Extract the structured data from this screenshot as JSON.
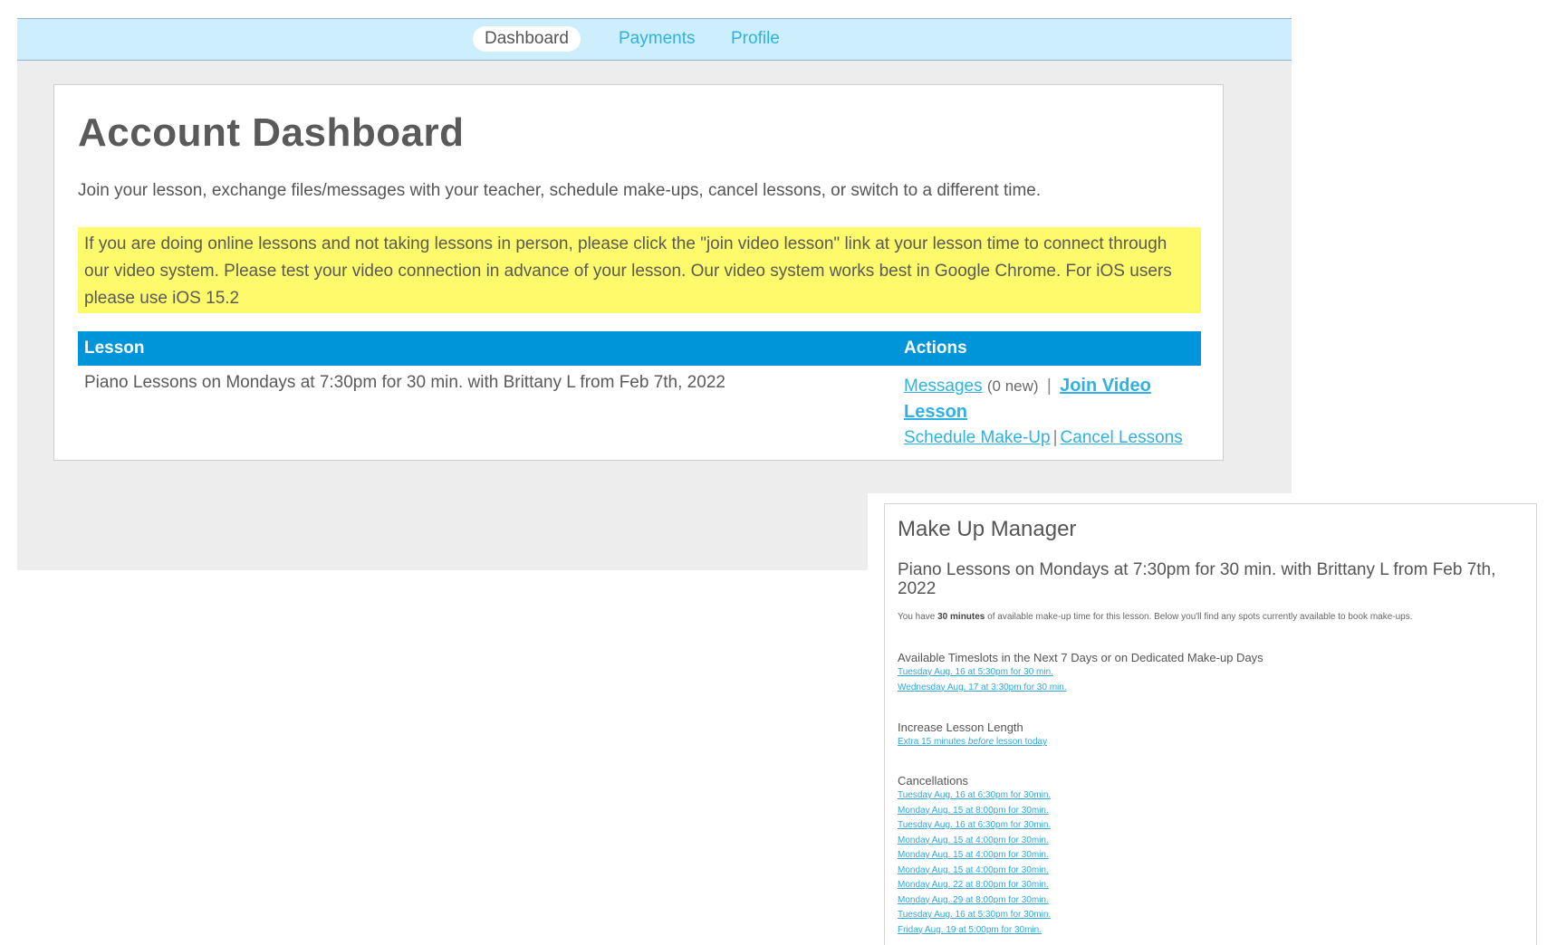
{
  "nav": {
    "items": [
      {
        "label": "Dashboard",
        "active": true
      },
      {
        "label": "Payments",
        "active": false
      },
      {
        "label": "Profile",
        "active": false
      }
    ]
  },
  "dashboard": {
    "title": "Account Dashboard",
    "intro": "Join your lesson, exchange files/messages with your teacher, schedule make-ups, cancel  lessons, or switch to a different time.",
    "notice": "If you are doing online lessons and not taking lessons in person, please click the \"join video lesson\" link at your lesson time to connect through our video system. Please test your video connection in advance of your lesson. Our video system works best in Google Chrome. For iOS users please use iOS 15.2",
    "table": {
      "col_lesson": "Lesson",
      "col_actions": "Actions",
      "row": {
        "lesson": "Piano Lessons on Mondays at 7:30pm for 30 min. with Brittany L from Feb 7th, 2022",
        "messages_label": "Messages",
        "messages_count": "(0 new)",
        "separator": "|",
        "join_label": "Join Video Lesson",
        "schedule_label": "Schedule Make-Up",
        "cancel_label": "Cancel Lessons"
      }
    }
  },
  "makeup": {
    "title": "Make Up Manager",
    "lesson": "Piano Lessons on Mondays at 7:30pm for 30 min. with Brittany L from Feb 7th, 2022",
    "note_prefix": "You have ",
    "note_bold": "30 minutes",
    "note_suffix": " of available make-up time for this lesson. Below you'll find any spots currently available to book make-ups.",
    "available": {
      "heading": "Available Timeslots in the Next 7 Days or on Dedicated Make-up Days",
      "slots": [
        "Tuesday Aug. 16 at 5:30pm for 30 min.",
        "Wednesday Aug. 17 at 3:30pm for 30 min."
      ]
    },
    "increase": {
      "heading": "Increase Lesson Length",
      "link_prefix": "Extra 15 minutes ",
      "link_em": "before",
      "link_suffix": " lesson today"
    },
    "cancellations": {
      "heading": "Cancellations",
      "slots": [
        "Tuesday Aug. 16 at 6:30pm for 30min.",
        "Monday Aug. 15 at 8:00pm for 30min.",
        "Tuesday Aug. 16 at 6:30pm for 30min.",
        "Monday Aug. 15 at 4:00pm for 30min.",
        "Monday Aug. 15 at 4:00pm for 30min.",
        "Monday Aug. 15 at 4:00pm for 30min.",
        "Monday Aug. 22 at 8:00pm for 30min.",
        "Monday Aug. 29 at 8:00pm for 30min.",
        "Tuesday Aug. 16 at 5:30pm for 30min.",
        "Friday Aug. 19 at 5:00pm for 30min."
      ]
    }
  }
}
